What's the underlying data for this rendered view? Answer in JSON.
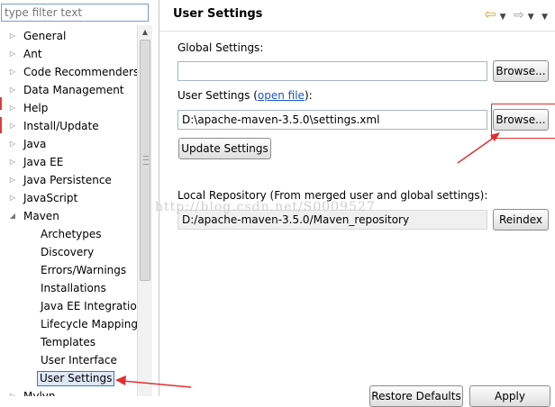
{
  "filter": {
    "placeholder": "type filter text"
  },
  "tree": {
    "top_items": [
      {
        "label": "General",
        "expanded": false
      },
      {
        "label": "Ant",
        "expanded": false
      },
      {
        "label": "Code Recommenders",
        "expanded": false
      },
      {
        "label": "Data Management",
        "expanded": false
      },
      {
        "label": "Help",
        "expanded": false
      },
      {
        "label": "Install/Update",
        "expanded": false
      },
      {
        "label": "Java",
        "expanded": false
      },
      {
        "label": "Java EE",
        "expanded": false
      },
      {
        "label": "Java Persistence",
        "expanded": false
      },
      {
        "label": "JavaScript",
        "expanded": false
      },
      {
        "label": "Maven",
        "expanded": true
      }
    ],
    "maven_children": [
      "Archetypes",
      "Discovery",
      "Errors/Warnings",
      "Installations",
      "Java EE Integration",
      "Lifecycle Mapping",
      "Templates",
      "User Interface",
      "User Settings"
    ],
    "selected": "User Settings",
    "after_item": "Mylyn"
  },
  "page": {
    "title": "User Settings",
    "icons": [
      "back-arrow-icon",
      "dropdown-icon",
      "forward-arrow-icon",
      "dropdown-icon",
      "view-menu-icon"
    ]
  },
  "global": {
    "label": "Global Settings:",
    "value": "",
    "browse": "Browse..."
  },
  "user": {
    "label_prefix": "User Settings (",
    "link": "open file",
    "label_suffix": "):",
    "value": "D:\\apache-maven-3.5.0\\settings.xml",
    "browse": "Browse...",
    "update": "Update Settings"
  },
  "local": {
    "label": "Local Repository (From merged user and global settings):",
    "value": "D:/apache-maven-3.5.0/Maven_repository",
    "reindex": "Reindex"
  },
  "bottom": {
    "restore_defaults": "Restore Defaults",
    "apply": "Apply"
  },
  "watermark": "http://blog.csdn.net/S0009527",
  "colors": {
    "annotation": "#e03030",
    "link": "#1a56c8",
    "selection": "#3b74c8"
  }
}
